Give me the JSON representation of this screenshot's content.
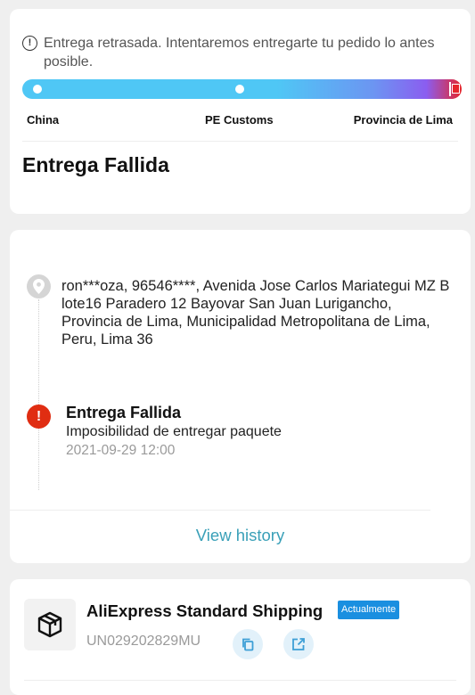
{
  "delivery_card": {
    "notice": "Entrega retrasada. Intentaremos entregarte tu pedido lo antes posible.",
    "stages": [
      "China",
      "PE Customs",
      "Provincia de Lima"
    ],
    "status_title": "Entrega Fallida",
    "progress_colors": {
      "start": "#4fc7f5",
      "end": "#e6262b"
    }
  },
  "tracking_card": {
    "address": "ron***oza,  96546****,  Avenida Jose Carlos Mariategui MZ B lote16 Paradero 12 Bayovar San Juan Lurigancho,  Provincia de Lima,  Municipalidad Metropolitana de Lima,  Peru,  Lima 36",
    "event": {
      "title": "Entrega Fallida",
      "description": "Imposibilidad de entregar paquete",
      "time": "2021-09-29 12:00",
      "icon": "exclamation-icon",
      "color": "#e02d12"
    },
    "view_history": "View history"
  },
  "shipping_card": {
    "carrier": "AliExpress Standard Shipping",
    "badge": "Actualmente",
    "tracking_number": "UN029202829MU",
    "copy_icon": "copy-icon",
    "open_icon": "external-link-icon"
  }
}
